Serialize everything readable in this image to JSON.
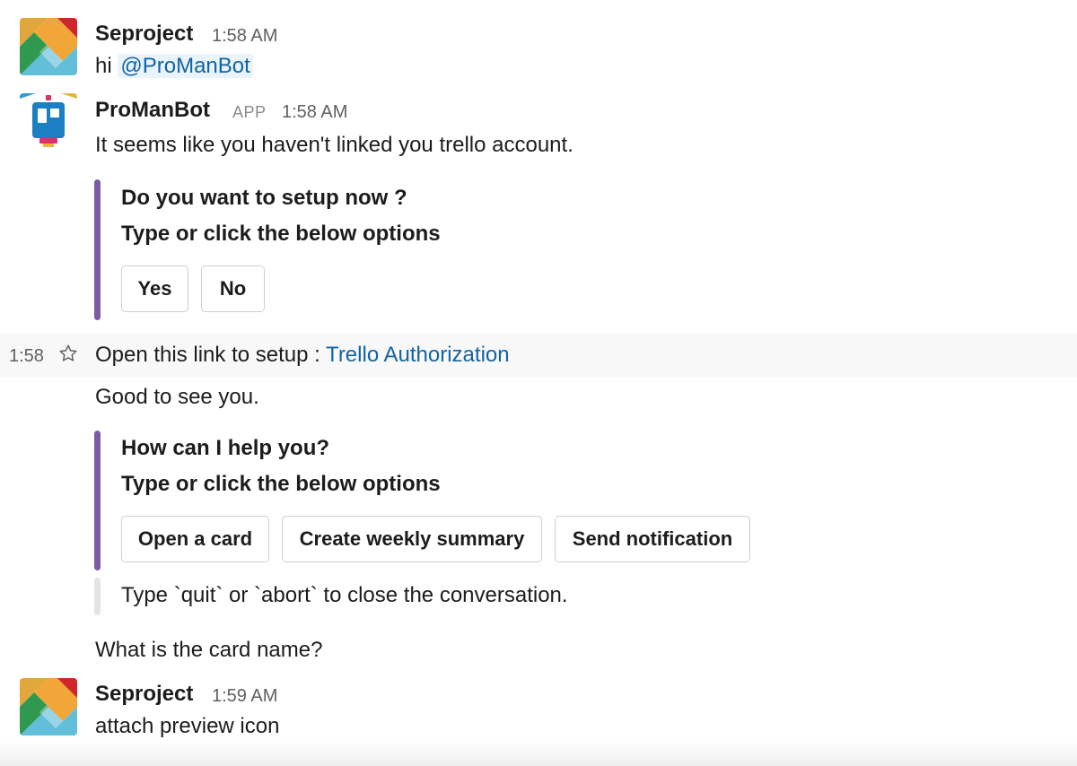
{
  "messages": {
    "m1": {
      "sender": "Seproject",
      "time": "1:58 AM",
      "text_prefix": "hi ",
      "mention": "@ProManBot"
    },
    "m2": {
      "sender": "ProManBot",
      "badge": "APP",
      "time": "1:58 AM",
      "text": "It seems like you haven't linked you trello account.",
      "attachment": {
        "line1": "Do you want to setup now ?",
        "line2": "Type or click the below options",
        "buttons": [
          "Yes",
          "No"
        ]
      }
    },
    "m3": {
      "hover_time": "1:58",
      "text_prefix": "Open this link to setup : ",
      "link": "Trello Authorization"
    },
    "m4": {
      "text": "Good to see you.",
      "attachment": {
        "line1": "How can I help you?",
        "line2": "Type or click the below options",
        "buttons": [
          "Open a card",
          "Create weekly summary",
          "Send notification"
        ]
      },
      "footer": "Type `quit` or `abort` to close the conversation."
    },
    "m5": {
      "text": "What is the card name?"
    },
    "m6": {
      "sender": "Seproject",
      "time": "1:59 AM",
      "text": "attach preview icon"
    }
  },
  "colors": {
    "link": "#1264a3",
    "attachment_bar": "#7b5aa6",
    "footer_bar": "#e4e4e4"
  },
  "icons": {
    "user_avatar": "colorful-diamond-avatar-icon",
    "bot_avatar": "robot-avatar-icon",
    "star": "star-outline-icon"
  }
}
